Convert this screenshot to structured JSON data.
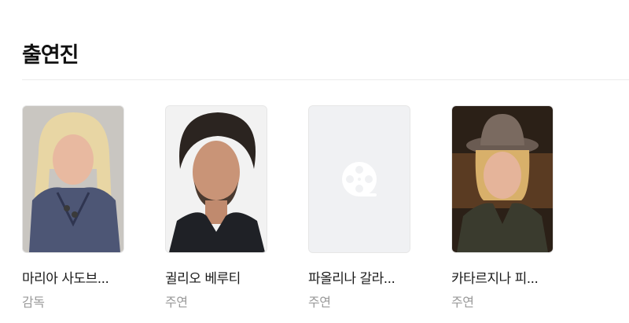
{
  "section": {
    "title": "출연진"
  },
  "cast": [
    {
      "name": "마리아 사도브...",
      "role": "감독",
      "photo": "photo-woman-blonde"
    },
    {
      "name": "귈리오 베루티",
      "role": "주연",
      "photo": "photo-man-curly-hair"
    },
    {
      "name": "파올리나 갈라...",
      "role": "주연",
      "photo": "film-reel-placeholder-icon"
    },
    {
      "name": "카타르지나 피...",
      "role": "주연",
      "photo": "photo-woman-hat"
    }
  ],
  "colors": {
    "placeholder_bg": "#f0f1f3",
    "role_text": "#9a9a9a"
  }
}
